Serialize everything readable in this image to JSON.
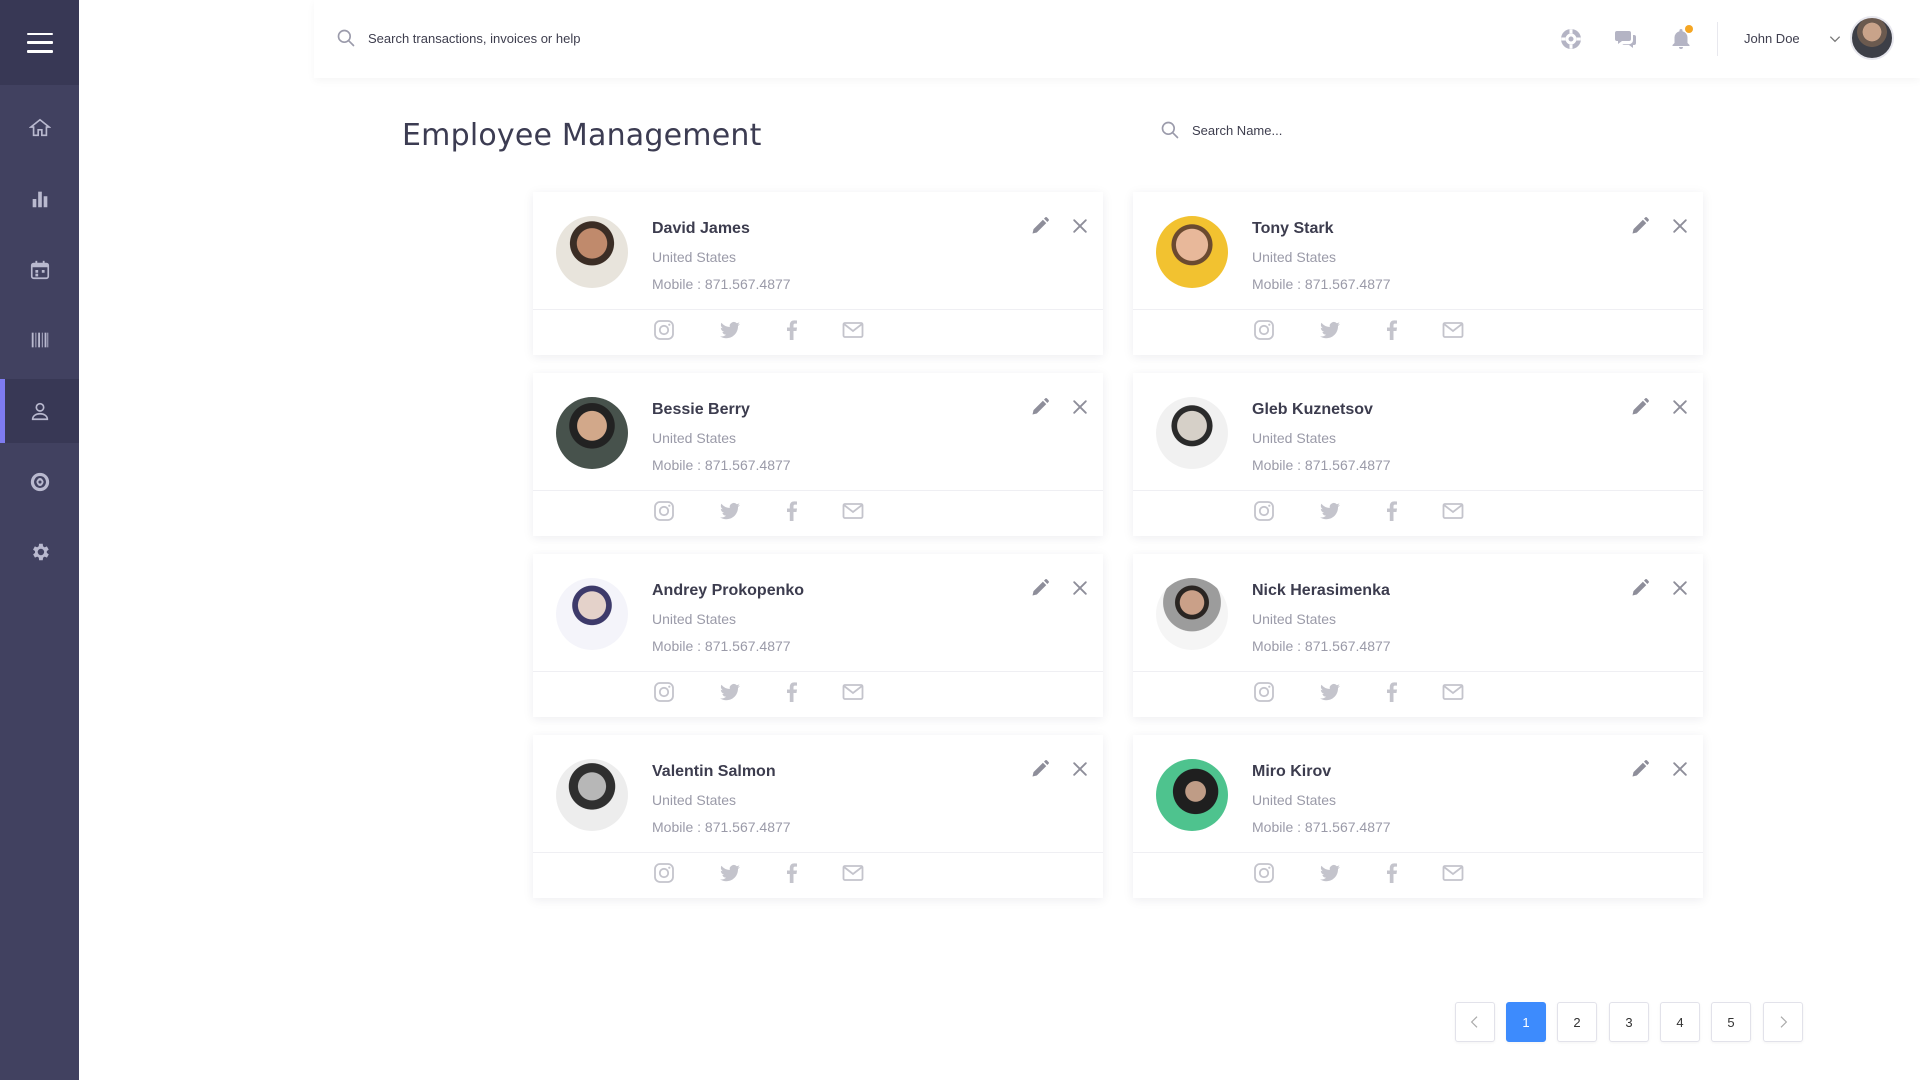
{
  "header": {
    "search_placeholder": "Search transactions, invoices or help",
    "user_name": "John Doe"
  },
  "page": {
    "title": "Employee Management",
    "name_search_placeholder": "Search Name..."
  },
  "sidebar": {
    "items": [
      {
        "icon": "home-icon"
      },
      {
        "icon": "bar-chart-icon"
      },
      {
        "icon": "calendar-icon"
      },
      {
        "icon": "barcode-icon"
      },
      {
        "icon": "user-icon",
        "active": true
      },
      {
        "icon": "globe-icon"
      },
      {
        "icon": "gear-icon"
      }
    ]
  },
  "employees": [
    {
      "name": "David James",
      "country": "United States",
      "mobile": "Mobile : 871.567.4877"
    },
    {
      "name": "Tony Stark",
      "country": "United States",
      "mobile": "Mobile : 871.567.4877"
    },
    {
      "name": "Bessie Berry",
      "country": "United States",
      "mobile": "Mobile : 871.567.4877"
    },
    {
      "name": "Gleb Kuznetsov",
      "country": "United States",
      "mobile": "Mobile : 871.567.4877"
    },
    {
      "name": "Andrey Prokopenko",
      "country": "United States",
      "mobile": "Mobile : 871.567.4877"
    },
    {
      "name": "Nick Herasimenka",
      "country": "United States",
      "mobile": "Mobile : 871.567.4877"
    },
    {
      "name": "Valentin Salmon",
      "country": "United States",
      "mobile": "Mobile : 871.567.4877"
    },
    {
      "name": "Miro Kirov",
      "country": "United States",
      "mobile": "Mobile : 871.567.4877"
    }
  ],
  "pagination": {
    "pages": [
      "1",
      "2",
      "3",
      "4",
      "5"
    ],
    "current": "1"
  },
  "colors": {
    "sidebar": "#414160",
    "accent": "#7e7bf0",
    "pager_active": "#3d8bfd",
    "notification_dot": "#f5a623"
  }
}
